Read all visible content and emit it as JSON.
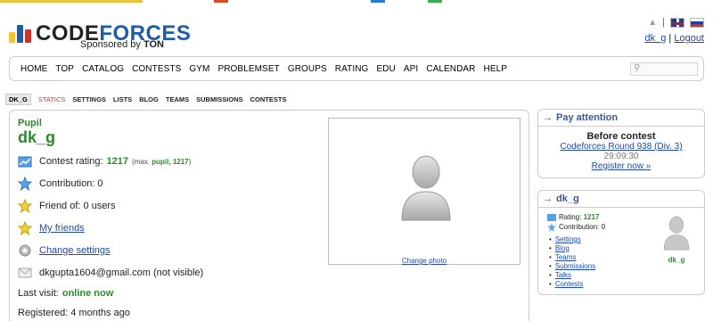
{
  "colors": {
    "green": "#2c8a2c",
    "link": "#1e4aa8",
    "logo_blue": "#1e5ca8",
    "caption": "#3b5998",
    "statics_red": "#cc3333"
  },
  "header": {
    "logo_text_1": "CODE",
    "logo_text_2": "FORCES",
    "sponsored_prefix": "Sponsored by ",
    "sponsor": "TON",
    "bell_icon": "bell-icon",
    "user_link": "dk_g",
    "separator": "|",
    "logout": "Logout"
  },
  "menu": {
    "items": [
      "HOME",
      "TOP",
      "CATALOG",
      "CONTESTS",
      "GYM",
      "PROBLEMSET",
      "GROUPS",
      "RATING",
      "EDU",
      "API",
      "CALENDAR",
      "HELP"
    ],
    "search_icon": "search-icon"
  },
  "subnav": {
    "items": [
      "DK_G",
      "STATICS",
      "SETTINGS",
      "LISTS",
      "BLOG",
      "TEAMS",
      "SUBMISSIONS",
      "CONTESTS"
    ]
  },
  "profile": {
    "rank": "Pupil",
    "handle": "dk_g",
    "rating_label": "Contest rating:",
    "rating": "1217",
    "max_prefix": "(max.",
    "max_rank": "pupil, 1217",
    "max_suffix": ")",
    "contribution": "Contribution: 0",
    "friend_of": "Friend of: 0 users",
    "my_friends": "My friends",
    "change_settings": "Change settings",
    "email": "dkgupta1604@gmail.com (not visible)",
    "last_visit_label": "Last visit:",
    "last_visit": "online now",
    "registered": "Registered: 4 months ago",
    "change_photo": "Change photo"
  },
  "pay_attention": {
    "caption": "Pay attention",
    "before_contest": "Before contest",
    "contest_link": "Codeforces Round 938 (Div. 3)",
    "timer": "29:09:30",
    "register_link": "Register now »"
  },
  "user_box": {
    "caption": "dk_g",
    "rating_label": "Rating:",
    "rating": "1217",
    "contribution": "Contribution: 0",
    "links": [
      "Settings",
      "Blog",
      "Teams",
      "Submissions",
      "Talks",
      "Contests"
    ],
    "handle": "dk_g"
  }
}
